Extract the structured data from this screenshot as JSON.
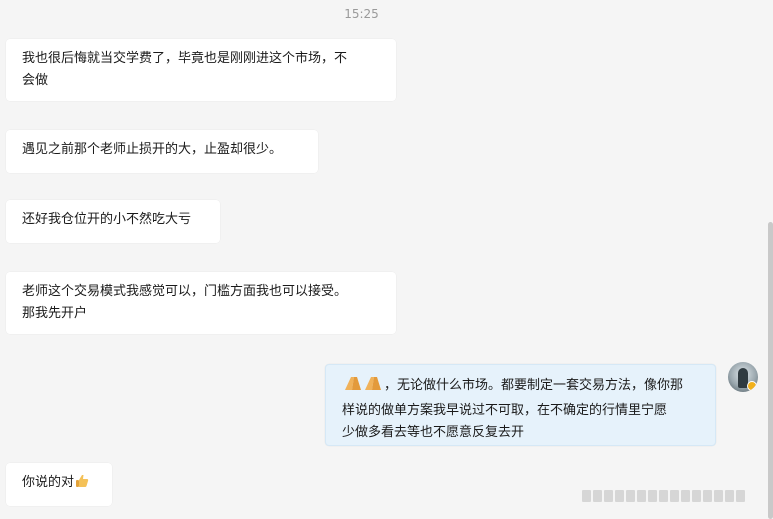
{
  "timestamp": "15:25",
  "messages": [
    {
      "sender": "other",
      "text": "我也很后悔就当交学费了，毕竟也是刚刚进这个市场，不\n会做"
    },
    {
      "sender": "other",
      "text": "遇见之前那个老师止损开的大，止盈却很少。"
    },
    {
      "sender": "other",
      "text": "还好我仓位开的小不然吃大亏"
    },
    {
      "sender": "other",
      "text": "老师这个交易模式我感觉可以，门槛方面我也可以接受。\n那我先开户"
    },
    {
      "sender": "me",
      "emoji": "folded-hands-emoji x2",
      "text": "，无论做什么市场。都要制定一套交易方法，像你那\n样说的做单方案我早说过不可取，在不确定的行情里宁愿\n少做多看去等也不愿意反复去开"
    },
    {
      "sender": "other",
      "text": "你说的对",
      "emoji": "thumbs-up-emoji"
    }
  ],
  "colors": {
    "background": "#f5f5f5",
    "bubble_other": "#ffffff",
    "bubble_me": "#e6f2fb",
    "timestamp": "#9a9a9a"
  },
  "icons": {
    "avatar": "user-avatar",
    "badge": "verified-badge-icon"
  }
}
